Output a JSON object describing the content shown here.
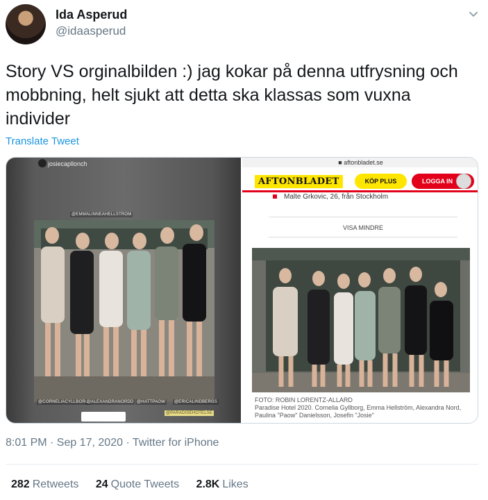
{
  "author": {
    "display_name": "Ida Asperud",
    "handle": "@idaasperud"
  },
  "icons": {
    "caret": "chevron-down-icon"
  },
  "tweet": {
    "text": "Story VS orginalbilden :) jag kokar på denna utfrysning och mobbning, helt sjukt att detta ska klassas som vuxna individer",
    "translate_label": "Translate Tweet",
    "timestamp": "8:01 PM · Sep 17, 2020 · Twitter for iPhone"
  },
  "story": {
    "username": "josiecapllonch",
    "tags": {
      "top": "@EMMALINNEAHELLSTROM",
      "t1": "@CORNELIACYLLBORG",
      "t2": "@ALEXANDRANORDD",
      "t3": "@HATTPAOW",
      "t4": "@ERICALINDBERGS",
      "location": "@PARADISEHOTELSE"
    }
  },
  "aftonbladet": {
    "url": "aftonbladet.se",
    "logo": "AFTONBLADET",
    "buy_button": "KÖP PLUS",
    "login_button": "LOGGA IN",
    "list_item": "Malte Grkovic, 26, från Stockholm",
    "show_less": "VISA MINDRE",
    "photo_credit": "FOTO: ROBIN LORENTZ-ALLARD",
    "caption": "Paradise Hotel 2020. Cornelia Gyllborg, Emma Hellström, Alexandra Nord, Paulina \"Paow\" Danielsson, Josefin \"Josie\""
  },
  "stats": [
    {
      "count": "282",
      "label": "Retweets"
    },
    {
      "count": "24",
      "label": "Quote Tweets"
    },
    {
      "count": "2.8K",
      "label": "Likes"
    }
  ],
  "colors": {
    "link": "#1b95e0",
    "secondary_text": "#657786",
    "aftonbladet_yellow": "#ffe600",
    "aftonbladet_red": "#e2001a"
  }
}
